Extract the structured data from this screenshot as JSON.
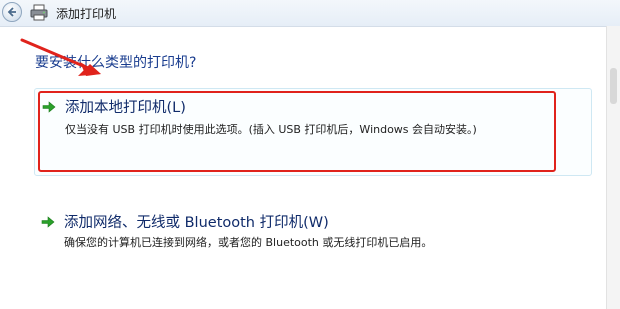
{
  "window": {
    "title": "添加打印机"
  },
  "main": {
    "prompt": "要安装什么类型的打印机?",
    "options": [
      {
        "title": "添加本地打印机(L)",
        "description": "仅当没有 USB 打印机时使用此选项。(插入 USB 打印机后，Windows 会自动安装。)"
      },
      {
        "title": "添加网络、无线或 Bluetooth 打印机(W)",
        "description": "确保您的计算机已连接到网络，或者您的 Bluetooth 或无线打印机已启用。"
      }
    ]
  },
  "colors": {
    "accent_title": "#1a3d8f",
    "annotation_red": "#e0231c",
    "option_arrow_green": "#2aa02a"
  },
  "icons": [
    "back-arrow-icon",
    "printer-icon",
    "green-arrow-icon"
  ]
}
